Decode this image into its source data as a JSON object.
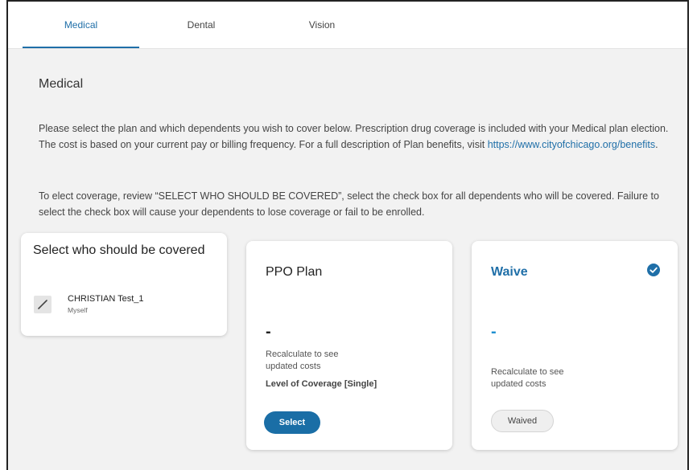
{
  "tabs": [
    {
      "label": "Medical",
      "active": true
    },
    {
      "label": "Dental",
      "active": false
    },
    {
      "label": "Vision",
      "active": false
    }
  ],
  "section": {
    "title": "Medical",
    "para1_text": "Please select the plan and which dependents you wish to cover below. Prescription drug coverage is included with your Medical plan election. The cost is based on your current pay or billing frequency. For a full description of Plan benefits, visit ",
    "para1_link": "https://www.cityofchicago.org/benefits",
    "para1_end": ".",
    "para2_text": "To elect coverage, review “SELECT WHO SHOULD BE COVERED”, select the check box for all dependents who will be covered. Failure to select the check box will cause your dependents to lose coverage or fail to be enrolled."
  },
  "cover_card": {
    "title": "Select who should be covered",
    "dependents": [
      {
        "name": "CHRISTIAN Test_1",
        "relation": "Myself"
      }
    ]
  },
  "plans": {
    "ppo": {
      "name": "PPO Plan",
      "cost": "-",
      "recalc": "Recalculate to see updated costs",
      "coverage_level": "Level of Coverage [Single]",
      "button_label": "Select"
    },
    "waive": {
      "name": "Waive",
      "cost": "-",
      "recalc": "Recalculate to see updated costs",
      "button_label": "Waived",
      "selected": true
    }
  },
  "colors": {
    "accent": "#1f6fa8",
    "button": "#1a6ea6",
    "background": "#f2f2f2"
  },
  "icons": {
    "dependent_checkbox": "edit-slash-icon",
    "waive_selected": "check-circle-icon"
  }
}
